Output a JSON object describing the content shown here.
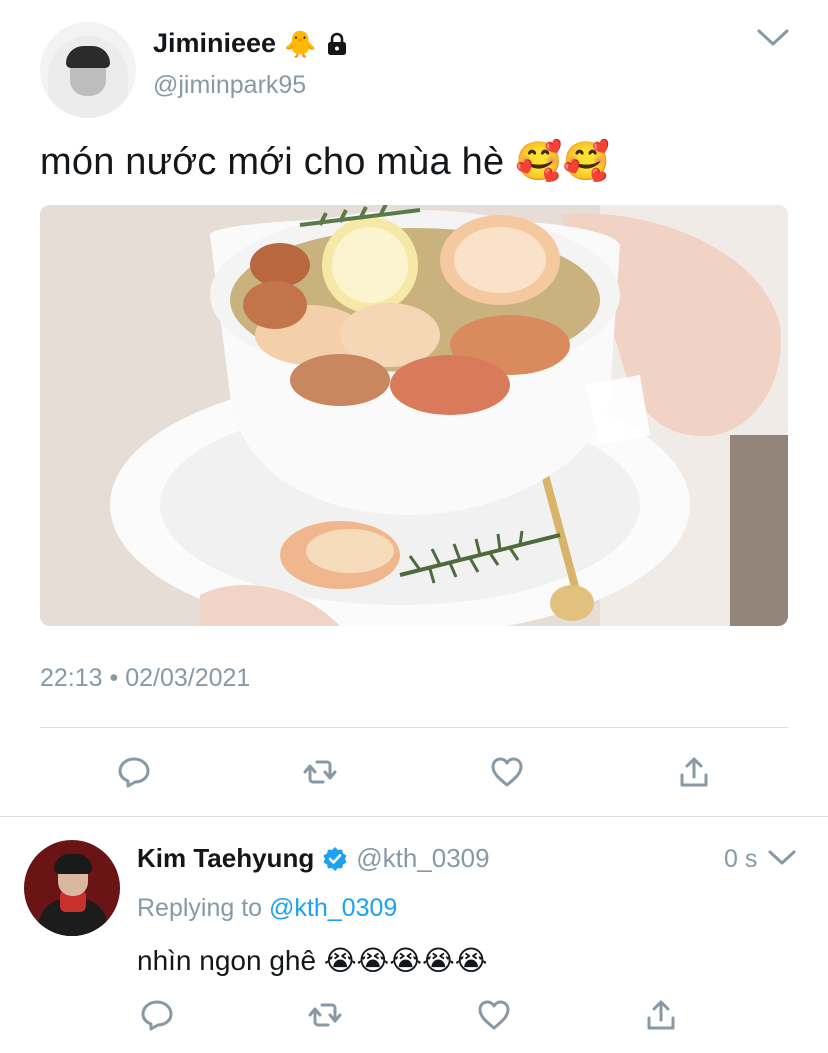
{
  "tweet": {
    "display_name": "Jiminieee",
    "name_emoji": "🐥",
    "handle": "@jiminpark95",
    "text": "món nước mới cho mùa hè 🥰🥰",
    "timestamp": "22:13 • 02/03/2021",
    "media_description_icon": "photo"
  },
  "reply": {
    "display_name": "Kim Taehyung",
    "handle": "@kth_0309",
    "time": "0 s",
    "replying_prefix": "Replying to",
    "replying_mention": "@kth_0309",
    "text": "nhìn ngon ghê 😭😭😭😭😭"
  },
  "icons": {
    "lock": "lock-icon",
    "verified": "verified-badge-icon",
    "reply": "reply-icon",
    "retweet": "retweet-icon",
    "like": "heart-icon",
    "share": "share-icon",
    "chevron": "chevron-down-icon"
  },
  "colors": {
    "text": "#14171a",
    "secondary": "#8899a6",
    "link": "#1da1f2",
    "divider": "#d7dde2"
  }
}
